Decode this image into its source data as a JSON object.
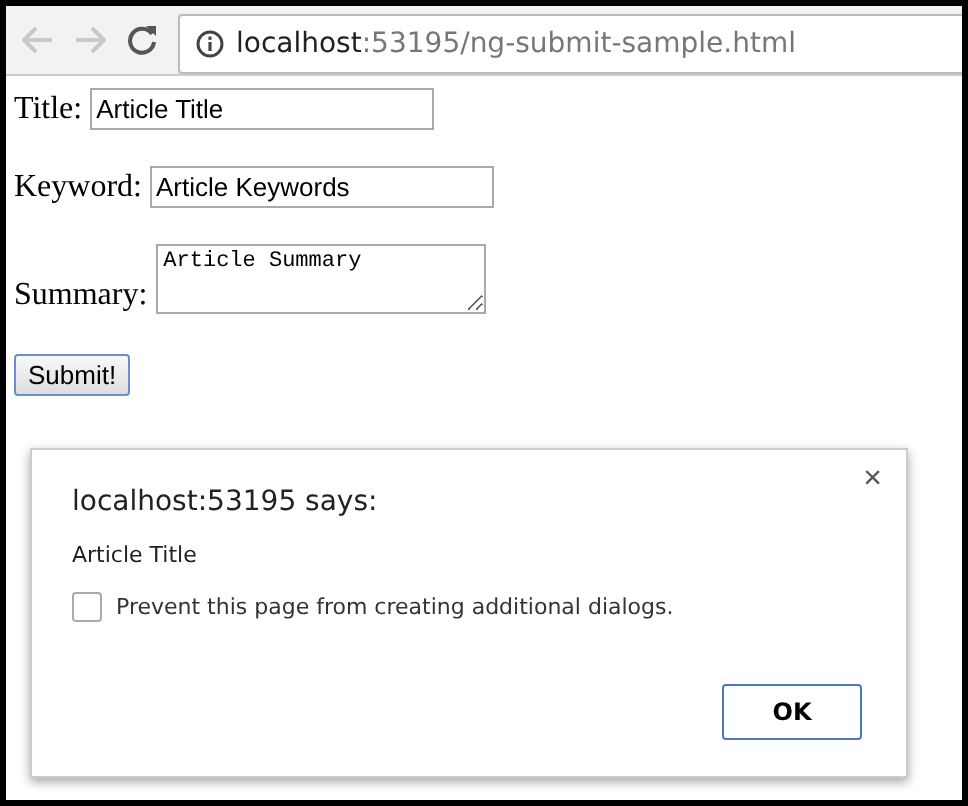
{
  "browser": {
    "address_host": "localhost",
    "address_path": ":53195/ng-submit-sample.html"
  },
  "form": {
    "fields": [
      {
        "kind": "input",
        "label": "Title:",
        "value": "Article Title"
      },
      {
        "kind": "input",
        "label": "Keyword:",
        "value": "Article Keywords"
      },
      {
        "kind": "textarea",
        "label": "Summary:",
        "value": "Article Summary"
      }
    ],
    "submit": "Submit!"
  },
  "dialog": {
    "title": "localhost:53195 says:",
    "close": "×",
    "message": "Article Title",
    "checkbox": {
      "label": "Prevent this page from creating additional dialogs.",
      "checked": false
    },
    "ok": "OK"
  }
}
